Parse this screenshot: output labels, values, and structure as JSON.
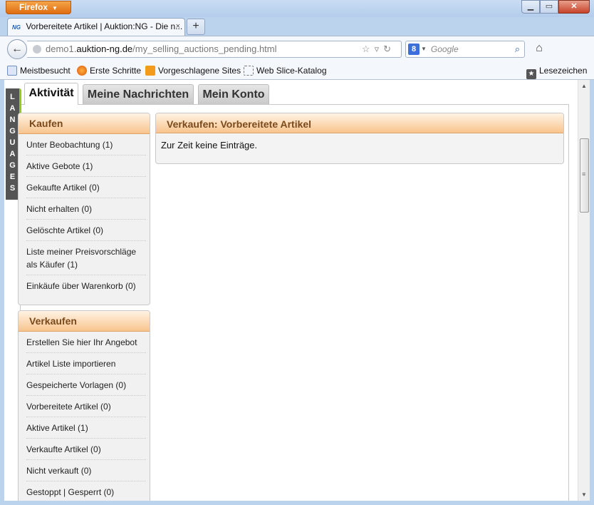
{
  "browser": {
    "menu_button": "Firefox",
    "window_controls": {
      "minimize": "▁",
      "maximize": "▭",
      "close": "✕"
    },
    "tab": {
      "favicon_text": "NG",
      "title": "Vorbereitete Artikel | Auktion:NG - Die n...",
      "close": "×"
    },
    "new_tab": "+",
    "url": {
      "prefix": "demo1.",
      "domain": "auktion-ng.de",
      "path": "/my_selling_auctions_pending.html"
    },
    "search": {
      "engine_letter": "8",
      "placeholder": "Google"
    },
    "bookmarks": [
      "Meistbesucht",
      "Erste Schritte",
      "Vorgeschlagene Sites",
      "Web Slice-Katalog"
    ],
    "bookmarks_menu": "Lesezeichen"
  },
  "page": {
    "languages_label": [
      "L",
      "A",
      "N",
      "G",
      "U",
      "A",
      "G",
      "E",
      "S"
    ],
    "tabs": [
      "Aktivität",
      "Meine Nachrichten",
      "Mein Konto"
    ],
    "kaufen": {
      "title": "Kaufen",
      "items": [
        "Unter Beobachtung (1)",
        "Aktive Gebote (1)",
        "Gekaufte Artikel (0)",
        "Nicht erhalten (0)",
        "Gelöschte Artikel (0)",
        "Liste meiner Preisvorschläge als Käufer (1)",
        "Einkäufe über Warenkorb (0)"
      ]
    },
    "verkaufen": {
      "title": "Verkaufen",
      "items": [
        "Erstellen Sie hier Ihr Angebot",
        "Artikel Liste importieren",
        "Gespeicherte Vorlagen (0)",
        "Vorbereitete Artikel (0)",
        "Aktive Artikel (1)",
        "Verkaufte Artikel (0)",
        "Nicht verkauft (0)",
        "Gestoppt | Gesperrt (0)"
      ]
    },
    "main_panel": {
      "title": "Verkaufen: Vorbereitete Artikel",
      "message": "Zur Zeit keine Einträge."
    }
  },
  "colors": {
    "accent_orange": "#f8c48d",
    "panel_title": "#7a4a1c",
    "languages_bar": "#555555",
    "languages_accent": "#97c61e"
  }
}
